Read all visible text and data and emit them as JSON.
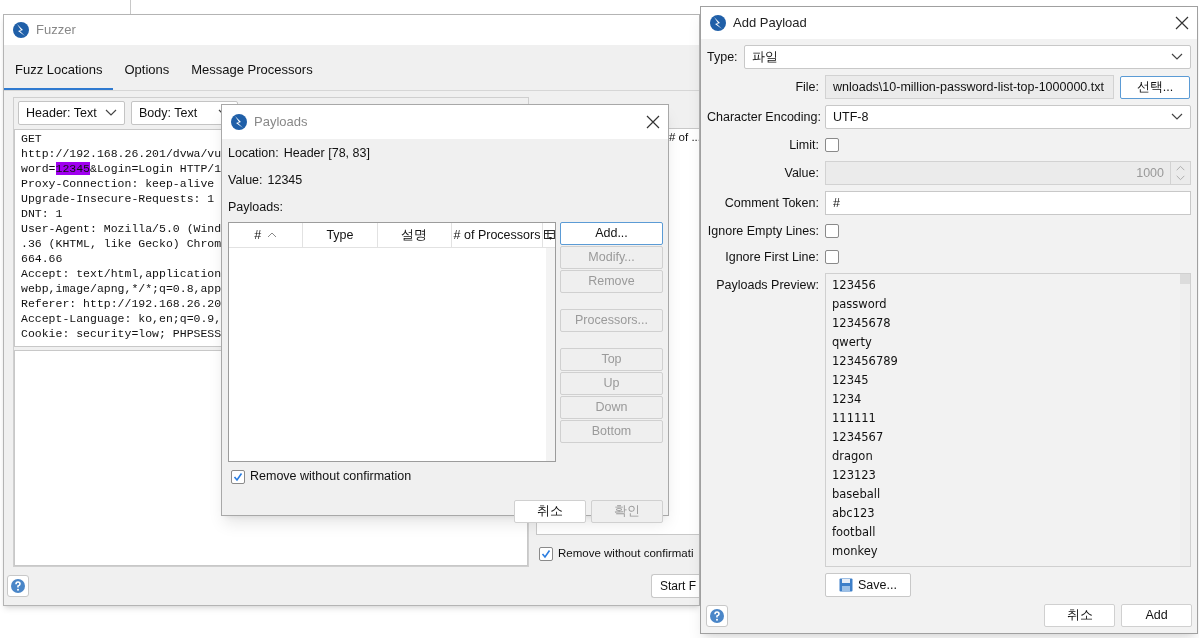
{
  "fuzzer": {
    "title": "Fuzzer",
    "tabs": [
      {
        "label": "Fuzz Locations",
        "selected": true
      },
      {
        "label": "Options",
        "selected": false
      },
      {
        "label": "Message Processors",
        "selected": false
      }
    ],
    "view_selects": [
      "Header: Text",
      "Body: Text"
    ],
    "request_lines": [
      {
        "text": "GET"
      },
      {
        "text": "http://192.168.26.201/dvwa/vu"
      },
      {
        "text": "word=",
        "mark": "12345",
        "tail": "&Login=Login HTTP/1"
      },
      {
        "text": "Proxy-Connection: keep-alive"
      },
      {
        "text": "Upgrade-Insecure-Requests: 1"
      },
      {
        "text": "DNT: 1"
      },
      {
        "text": "User-Agent: Mozilla/5.0 (Wind"
      },
      {
        "text": ".36 (KHTML, like Gecko) Chrom"
      },
      {
        "text": "664.66"
      },
      {
        "text": "Accept: text/html,application"
      },
      {
        "text": "webp,image/apng,*/*;q=0.8,app"
      },
      {
        "text": "Referer: http://192.168.26.20"
      },
      {
        "text": "Accept-Language: ko,en;q=0.9,"
      },
      {
        "text": "Cookie: security=low; PHPSESS"
      }
    ],
    "table_column": "# of ...",
    "remove_without_confirmation": {
      "label": "Remove without confirmati",
      "checked": true
    },
    "start_button": "Start F"
  },
  "payloads_dialog": {
    "title": "Payloads",
    "location_label": "Location:",
    "location": "Header [78, 83]",
    "value_label": "Value:",
    "value": "12345",
    "payloads_label": "Payloads:",
    "columns": [
      {
        "label": "#",
        "sorted": true
      },
      {
        "label": "Type",
        "sorted": false
      },
      {
        "label": "설명",
        "sorted": false
      },
      {
        "label": "# of Processors",
        "sorted": false
      }
    ],
    "button_groups": [
      [
        {
          "label": "Add...",
          "disabled": false
        },
        {
          "label": "Modify...",
          "disabled": true
        },
        {
          "label": "Remove",
          "disabled": true
        }
      ],
      [
        {
          "label": "Processors...",
          "disabled": true
        }
      ],
      [
        {
          "label": "Top",
          "disabled": true
        },
        {
          "label": "Up",
          "disabled": true
        },
        {
          "label": "Down",
          "disabled": true
        },
        {
          "label": "Bottom",
          "disabled": true
        }
      ]
    ],
    "remove_without_confirmation": {
      "label": "Remove without confirmation",
      "checked": true
    },
    "footer_buttons": [
      {
        "label": "취소",
        "disabled": false
      },
      {
        "label": "확인",
        "disabled": true
      }
    ]
  },
  "add_payload": {
    "title": "Add Payload",
    "type_label": "Type:",
    "type": "파일",
    "file_label": "File:",
    "file": "wnloads\\10-million-password-list-top-1000000.txt",
    "choose_button": "선택...",
    "encoding_label": "Character Encoding:",
    "encoding": "UTF-8",
    "limit": {
      "label": "Limit:",
      "checked": false
    },
    "value_label": "Value:",
    "value": "1000",
    "comment_label": "Comment Token:",
    "comment": "#",
    "ignore_empty_lines": {
      "label": "Ignore Empty Lines:",
      "checked": false
    },
    "ignore_first_line": {
      "label": "Ignore First Line:",
      "checked": false
    },
    "preview_label": "Payloads Preview:",
    "preview": [
      "123456",
      "password",
      "12345678",
      "qwerty",
      "123456789",
      "12345",
      "1234",
      "111111",
      "1234567",
      "dragon",
      "123123",
      "baseball",
      "abc123",
      "football",
      "monkey"
    ],
    "save_button": "Save...",
    "cancel_button": "취소",
    "add_button": "Add"
  }
}
